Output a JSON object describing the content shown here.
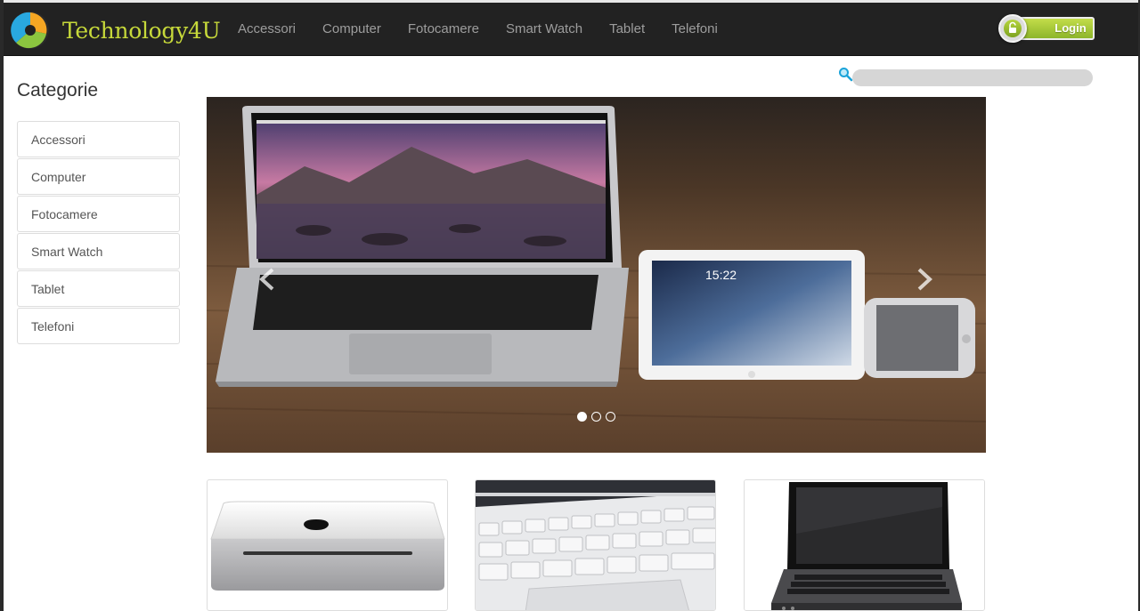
{
  "brand": {
    "name": "Technology4U"
  },
  "nav": {
    "items": [
      "Accessori",
      "Computer",
      "Fotocamere",
      "Smart Watch",
      "Tablet",
      "Telefoni"
    ]
  },
  "login": {
    "label": "Login"
  },
  "sidebar": {
    "title": "Categorie",
    "items": [
      "Accessori",
      "Computer",
      "Fotocamere",
      "Smart Watch",
      "Tablet",
      "Telefoni"
    ]
  },
  "search": {
    "value": "",
    "placeholder": ""
  },
  "carousel": {
    "slide_count": 3,
    "active_index": 0,
    "slide_image": "laptop-tablet-phone-on-wooden-desk"
  },
  "products": [
    {
      "image": "mac-mini"
    },
    {
      "image": "asus-laptop-keyboard"
    },
    {
      "image": "black-laptop"
    }
  ],
  "icons": {
    "search": "magnifier-icon",
    "login": "unlock-icon",
    "prev": "chevron-left-icon",
    "next": "chevron-right-icon"
  },
  "colors": {
    "navbar": "#222222",
    "brand_text": "#c7d93a",
    "login_green": "#a5c93a",
    "search_bg": "#d6d6d6"
  }
}
